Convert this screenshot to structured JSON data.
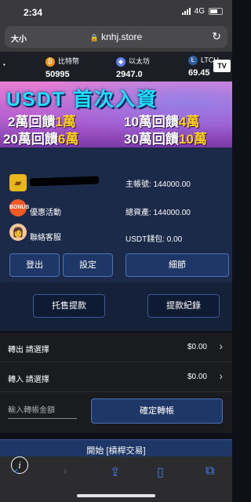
{
  "status_bar": {
    "time": "2:34",
    "network": "4G"
  },
  "browser": {
    "aa_label": "大小",
    "url": "knhj.store"
  },
  "ticker": [
    {
      "icon": "bitcoin-icon",
      "symbol": "₿",
      "name": "比特幣",
      "price": "50995",
      "color": "#f7931a"
    },
    {
      "icon": "ethereum-icon",
      "symbol": "◆",
      "name": "以太坊",
      "price": "2947.0",
      "color": "#627eea"
    },
    {
      "icon": "litecoin-icon",
      "symbol": "Ł",
      "name": "LTCU",
      "price": "69.45",
      "color": "#345d9d"
    }
  ],
  "ticker_badge": "TV",
  "banner": {
    "title": "USDT 首次入資",
    "line1_left": [
      "2萬回饋",
      "1萬"
    ],
    "line1_right": [
      "10萬回饋",
      "4萬"
    ],
    "line2_left": [
      "20萬回饋",
      "6萬"
    ],
    "line2_right": [
      "30萬回饋",
      "10萬"
    ]
  },
  "account": {
    "promo_label": "優惠活動",
    "service_label": "聯絡客服",
    "main_account": "主帳號: 144000.00",
    "total_assets": "總資產: 144000.00",
    "usdt_wallet": "USDT錢包: 0.00",
    "login_button": "登出",
    "settings_button": "設定",
    "details_button": "細節",
    "promo_icon_text": "BONUS"
  },
  "actions": {
    "sell_withdraw": "托售提款",
    "withdraw_records": "提款紀錄"
  },
  "transfer_out": {
    "label": "轉出 請選擇",
    "amount": "$0.00"
  },
  "transfer_in": {
    "label": "轉入 請選擇",
    "amount": "$0.00"
  },
  "transfer": {
    "placeholder": "輸入轉帳金額",
    "confirm_button": "確定轉帳"
  },
  "start_button": "開始 [槓桿交易]",
  "info_icon": "i"
}
